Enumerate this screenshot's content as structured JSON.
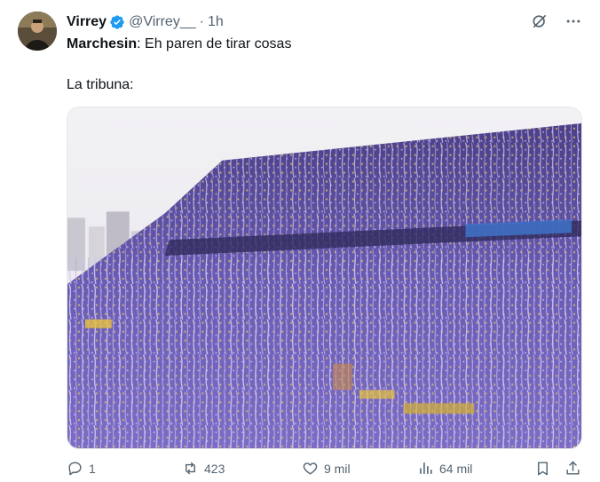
{
  "tweet": {
    "author_name": "Virrey",
    "handle": "@Virrey__",
    "separator": "·",
    "time": "1h",
    "line1_bold": "Marchesin",
    "line1_rest": ": Eh paren de tirar cosas",
    "line2": "La tribuna:"
  },
  "actions": {
    "replies": "1",
    "reposts": "423",
    "likes": "9 mil",
    "views": "64 mil"
  },
  "colors": {
    "verified": "#1d9bf0",
    "muted": "#536471",
    "text": "#0f1419",
    "confetti": "#8a78d8"
  }
}
